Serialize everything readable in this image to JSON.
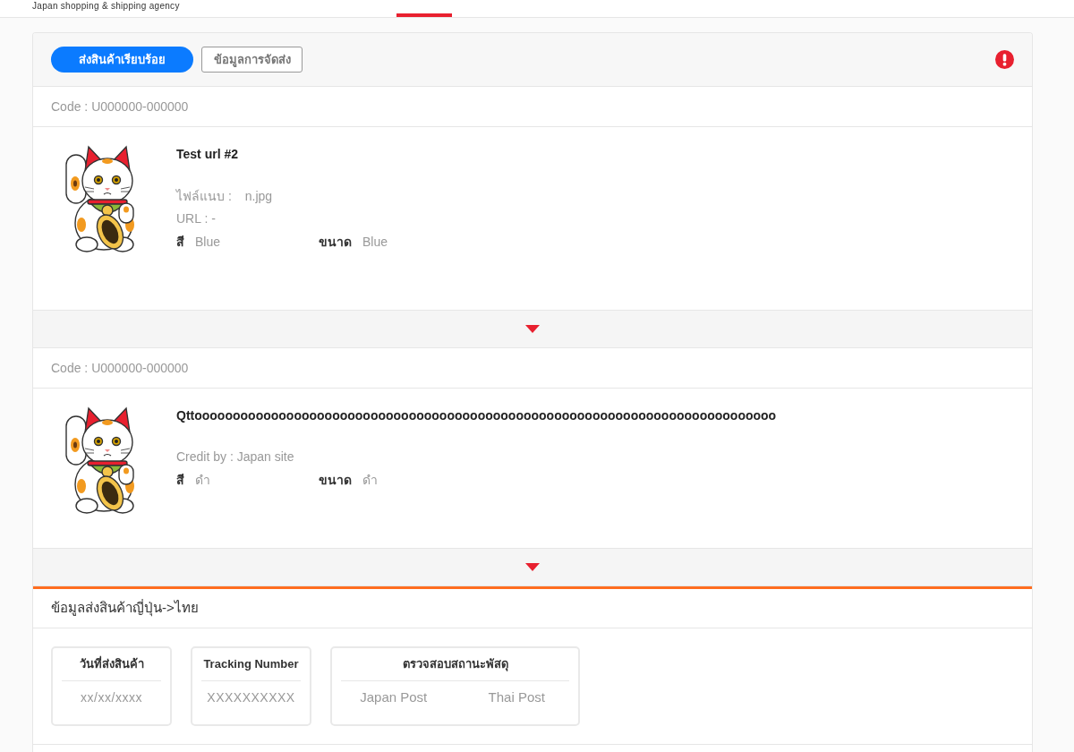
{
  "header": {
    "tagline": "Japan shopping & shipping agency",
    "tabs": [
      {
        "selected": true
      }
    ]
  },
  "order": {
    "actions": [
      {
        "label": "ส่งสินค้าเรียบร้อย",
        "kind": "primary"
      },
      {
        "label": "ข้อมูลการจัดส่ง",
        "kind": "outline"
      }
    ],
    "alert": true
  },
  "items": [
    {
      "code": "Code : U000000-000000",
      "title": "Test url #2",
      "details": [
        {
          "kind": "pair",
          "label": "ไฟล์แนบ :",
          "value": "n.jpg"
        },
        {
          "kind": "line",
          "text": "URL : -"
        }
      ],
      "options": [
        {
          "label": "สี",
          "value": "Blue"
        },
        {
          "label": "ขนาด",
          "value": "Blue"
        }
      ],
      "expanded": false
    },
    {
      "code": "Code : U000000-000000",
      "title": "Qttoooooooooooooooooooooooooooooooooooooooooooooooooooooooooooooooooooooooooooo",
      "details": [
        {
          "kind": "line",
          "text": "Credit by : Japan site"
        }
      ],
      "options": [
        {
          "label": "สี",
          "value": "ดำ"
        },
        {
          "label": "ขนาด",
          "value": "ดำ"
        }
      ],
      "expanded": false
    }
  ],
  "shipping": {
    "title": "ข้อมูลส่งสินค้าญี่ปุ่น->ไทย",
    "boxes": [
      {
        "heading": "วันที่ส่งสินค้า",
        "kind": "text",
        "values": [
          "xx/xx/xxxx"
        ]
      },
      {
        "heading": "Tracking Number",
        "kind": "text",
        "values": [
          "XXXXXXXXXX"
        ]
      },
      {
        "heading": "ตรวจสอบสถานะพัสดุ",
        "kind": "links",
        "values": [
          "Japan Post",
          "Thai Post"
        ]
      }
    ]
  }
}
